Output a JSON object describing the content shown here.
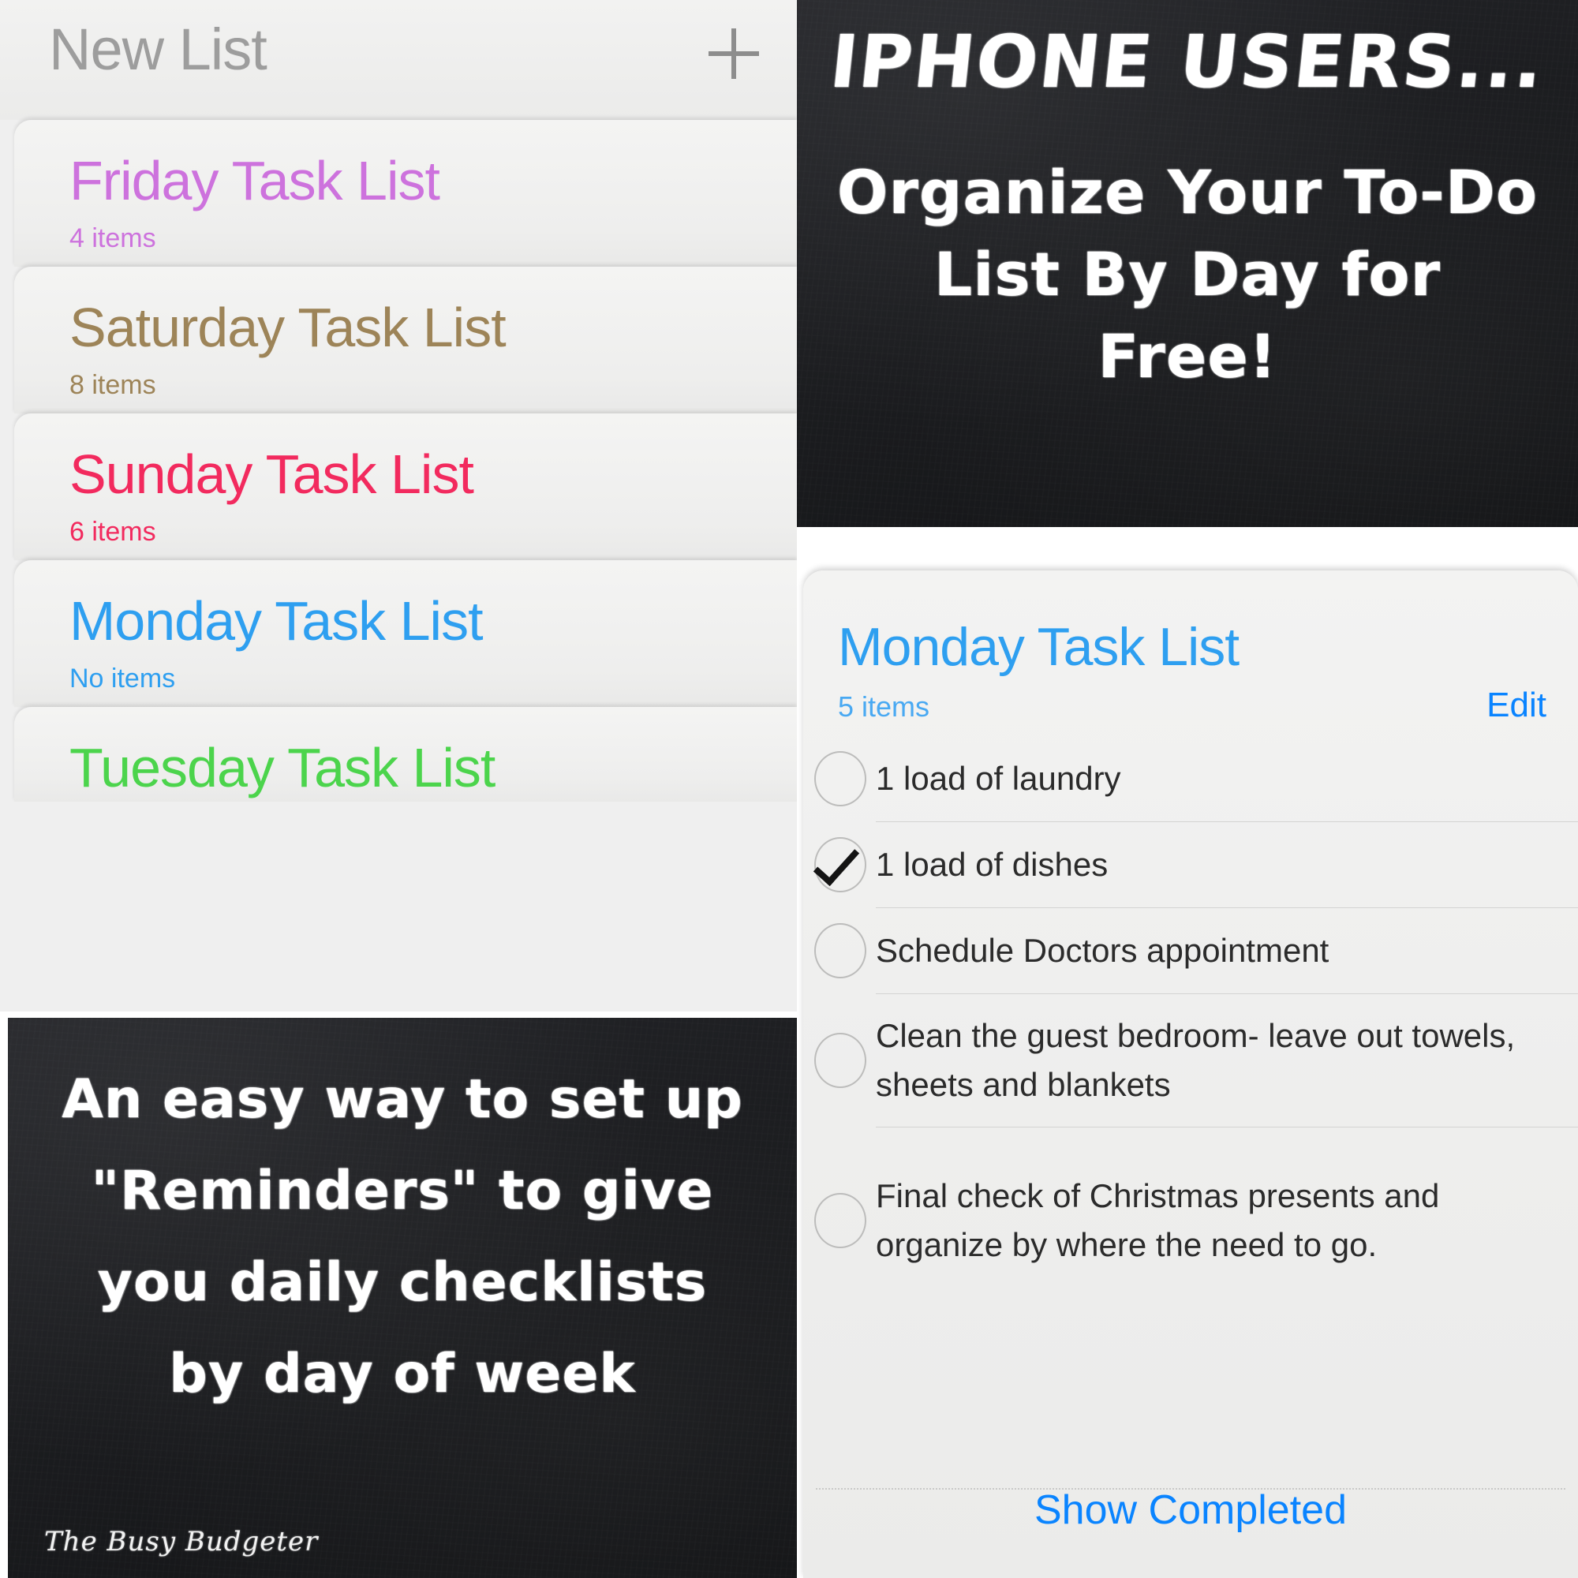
{
  "lists_panel": {
    "header_title": "New List",
    "add_icon": "plus-icon",
    "rows": [
      {
        "name": "Friday Task List",
        "count": "4 items",
        "color": "#cd72dd"
      },
      {
        "name": "Saturday Task List",
        "count": "8 items",
        "color": "#9d8458"
      },
      {
        "name": "Sunday Task List",
        "count": "6 items",
        "color": "#f22a5e"
      },
      {
        "name": "Monday Task List",
        "count": "No items",
        "color": "#2e9ff0"
      },
      {
        "name": "Tuesday Task List",
        "count": "",
        "color": "#4cd44c"
      }
    ]
  },
  "promo_top": {
    "line1": "IPHONE USERS...",
    "line2": "Organize Your To-Do",
    "line3": "List By Day for",
    "line4": "Free!"
  },
  "promo_bottom": {
    "line1": "An easy way to set up",
    "line2": "\"Reminders\" to give",
    "line3": "you daily checklists",
    "line4": "by day of week",
    "watermark": "The Busy Budgeter"
  },
  "detail_panel": {
    "title": "Monday Task List",
    "count": "5 items",
    "edit_label": "Edit",
    "show_completed_label": "Show Completed",
    "tasks": [
      {
        "text": "1 load of laundry",
        "done": false
      },
      {
        "text": "1 load of dishes",
        "done": true
      },
      {
        "text": "Schedule Doctors appointment",
        "done": false
      },
      {
        "text": "Clean the guest bedroom- leave out towels, sheets and blankets",
        "done": false
      },
      {
        "text": "Final check of Christmas presents and organize by where the need to go.",
        "done": false
      }
    ]
  }
}
